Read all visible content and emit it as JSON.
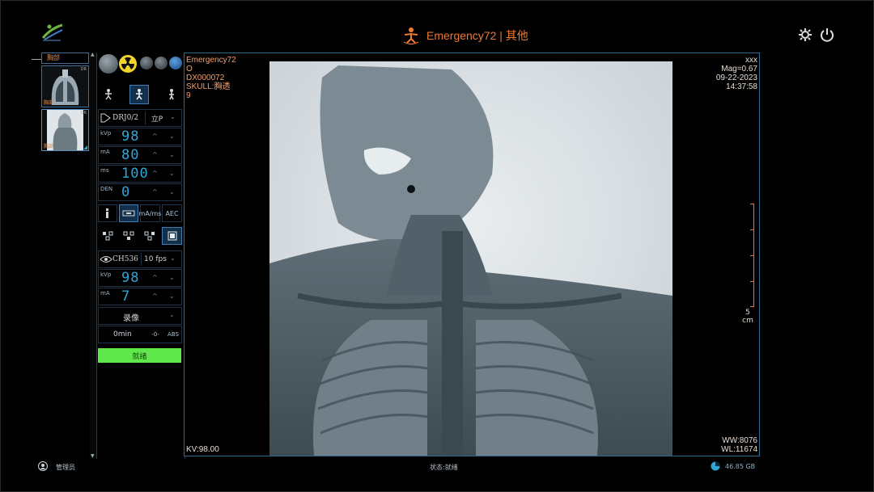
{
  "header": {
    "title": "Emergency72 | 其他",
    "brand_color": "#f07a2e",
    "icons": [
      "patient-icon",
      "gear-icon",
      "power-icon"
    ]
  },
  "thumbnails": {
    "header_label": "胸部",
    "items": [
      {
        "label": "胸部",
        "num": "DR"
      },
      {
        "label": "胸部",
        "num": "DR"
      }
    ]
  },
  "controls": {
    "detector": "DRJ0/2",
    "position": "立P",
    "kvp_label": "kVp",
    "kvp": "98",
    "ma_label": "mA",
    "ma": "80",
    "ms_label": "ms",
    "ms": "100",
    "den_label": "DEN",
    "den": "0",
    "mode_buttons": [
      "mA/ms",
      "AEC"
    ],
    "fluoro": {
      "detector": "CH536",
      "fps": "10 fps",
      "kvp_label": "kVp",
      "kvp": "98",
      "ma_label": "mA",
      "ma": "7",
      "record": "录像",
      "time": "0min",
      "btn_a": "-0-",
      "btn_b": "ABS"
    },
    "action": "就绪"
  },
  "viewer": {
    "top_left": [
      "Emergency72",
      "O",
      "DX000072",
      "SKULL:胸透",
      "9"
    ],
    "top_right": [
      "xxx",
      "Mag=0.67",
      "09-22-2023",
      "14:37:58"
    ],
    "kv": "KV:98.00",
    "ww": "WW:8076",
    "wl": "WL:11674",
    "scale_value": "5",
    "scale_unit": "cm"
  },
  "footer": {
    "user": "管理员",
    "status": "状态:就绪",
    "disk": "46.85 GB"
  }
}
